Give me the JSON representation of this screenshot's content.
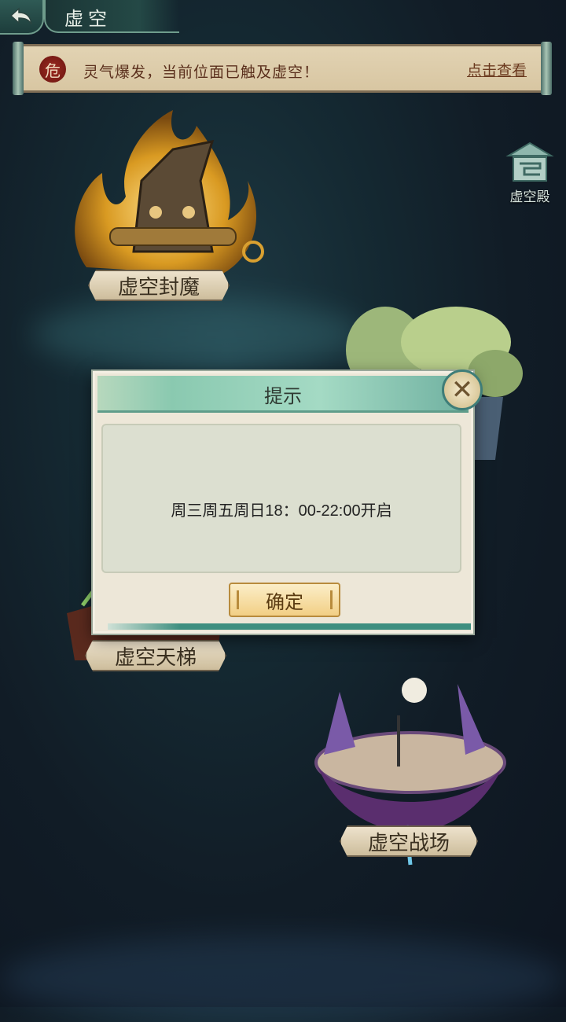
{
  "header": {
    "title": "虚空"
  },
  "notice": {
    "seal": "危",
    "text": "灵气爆发，当前位面已触及虚空！",
    "link": "点击查看"
  },
  "void_hall": {
    "label": "虚空殿"
  },
  "nodes": {
    "seal_demon": "虚空封魔",
    "sky_ladder": "虚空天梯",
    "battlefield": "虚空战场"
  },
  "dialog": {
    "title": "提示",
    "message": "周三周五周日18：00-22:00开启",
    "confirm_label": "确定",
    "close_glyph": "✕"
  },
  "colors": {
    "accent_teal": "#3e8f80",
    "button_gold": "#f2cf85",
    "notice_paper": "#e2d3b3"
  }
}
